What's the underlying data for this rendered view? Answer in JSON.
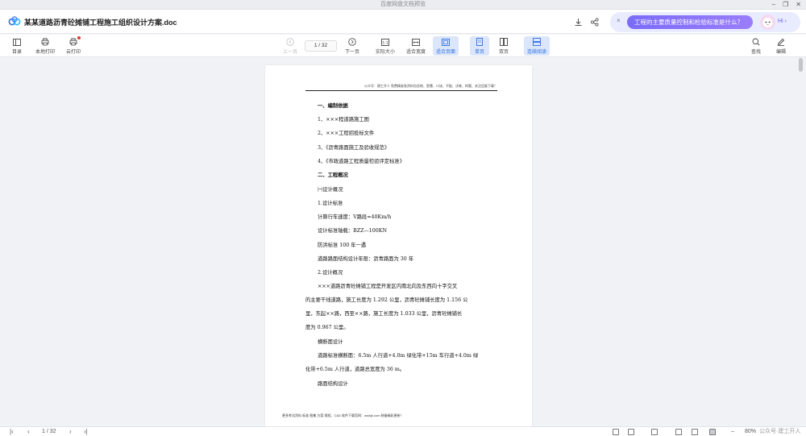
{
  "window": {
    "title": "百度网盘文档预览",
    "controls": [
      "–",
      "❐",
      "✕"
    ]
  },
  "header": {
    "doc_title": "某某道路沥青砼摊铺工程施工组织设计方案.doc",
    "ai_close": "×",
    "ai_question": "工程的主要质量控制和检验标准是什么？",
    "ai_hi": "Hi ›"
  },
  "toolbar": {
    "left": [
      {
        "label": "目录",
        "icon": "toc-icon"
      },
      {
        "label": "本地打印",
        "icon": "print-icon"
      },
      {
        "label": "云打印",
        "icon": "cloud-print-icon"
      }
    ],
    "prev_label": "上一页",
    "page_indicator": "1 / 32",
    "next_label": "下一页",
    "view_modes": [
      {
        "label": "实际大小",
        "active": false
      },
      {
        "label": "适合宽度",
        "active": false
      },
      {
        "label": "适合页面",
        "active": true
      },
      {
        "label": "单页",
        "active": true
      },
      {
        "label": "双页",
        "active": false
      },
      {
        "label": "连续阅读",
        "active": true
      }
    ],
    "search_label": "查找",
    "edit_label": "编辑"
  },
  "document": {
    "header_text": "公众号：建工开人 免费精准各资料包含地、智慧、口诀、不配、试卷、样题、关注回复下载！",
    "lines": [
      {
        "text": "一、编制依据",
        "bold": true
      },
      {
        "text": "1、×××程道路施工图",
        "bold": false
      },
      {
        "text": "2、×××工程招投标文件",
        "bold": false
      },
      {
        "text": "3、《沥青路面施工及验收规范》",
        "bold": false
      },
      {
        "text": "4、《市政道路工程质量检验评定标准》",
        "bold": false
      },
      {
        "text": "二、工程概况",
        "bold": true
      },
      {
        "text": "㈠设计概况",
        "bold": false
      },
      {
        "text": "1.设计标准",
        "bold": false
      },
      {
        "text": "计算行车速度：V路段=40Km/h",
        "bold": false
      },
      {
        "text": "设计标准轴载：BZZ—100KN",
        "bold": false
      },
      {
        "text": "防洪标准 100 年一遇",
        "bold": false
      },
      {
        "text": "道路路面结构设计年限：沥青路面为 30 年",
        "bold": false
      },
      {
        "text": "2.设计概况",
        "bold": false
      },
      {
        "text": "×××道路沥青砼摊铺工程是开发区内南北向及东西向十字交叉",
        "bold": false
      },
      {
        "text": "的主要干线道路，施工长度为 1.292 公里，沥青砼摊铺长度为 1.156 公",
        "bold": false
      },
      {
        "text": "里，东起××路，西至××路，施工长度为 1.033 公里，沥青砼摊铺长",
        "bold": false
      },
      {
        "text": "度为 0.967 公里。",
        "bold": false
      },
      {
        "text": "横断面设计",
        "bold": false
      },
      {
        "text": "道路标准横断面：6.5m 人行道+4.0m 绿化带+15m 车行道+4.0m 绿",
        "bold": false
      },
      {
        "text": "化带+6.5m 人行道，道路总宽度为 36 m。",
        "bold": false
      },
      {
        "text": "路面结构设计",
        "bold": false
      }
    ],
    "footer_text": "更多考试资料 标准 图集 方案 规程、CAD 软件下载官网：wsinjk.com 装备精彩更新！"
  },
  "statusbar": {
    "page_indicator": "1 / 32",
    "zoom": "80%",
    "watermark": "公众号·建工开人"
  },
  "colors": {
    "accent": "#2f6fe0",
    "ai_gradient_start": "#7a6cf7",
    "ai_gradient_end": "#9a7dfa",
    "badge": "#e53935"
  }
}
